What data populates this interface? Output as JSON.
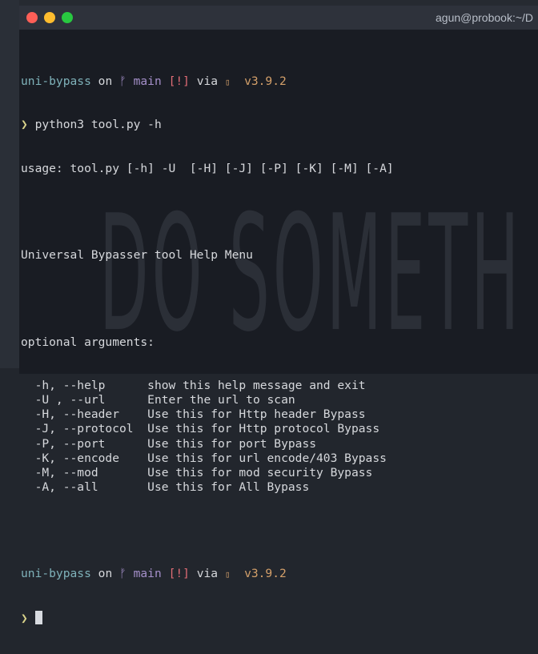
{
  "window": {
    "title": "agun@probook:~/D"
  },
  "prompt": {
    "dir": "uni-bypass",
    "on": "on",
    "branch_icon": "git-branch-icon",
    "branch_glyph": "ᚠ",
    "branch": "main",
    "status": "[!]",
    "via": "via",
    "python_icon": "python-icon",
    "python_glyph": "▯",
    "version": "v3.9.2",
    "arrow": "❯"
  },
  "command": "python3 tool.py -h",
  "usage": "usage: tool.py [-h] -U  [-H] [-J] [-P] [-K] [-M] [-A]",
  "heading": "Universal Bypasser tool Help Menu",
  "section": "optional arguments:",
  "arguments": [
    {
      "flag": "  -h, --help      ",
      "desc": "show this help message and exit"
    },
    {
      "flag": "  -U , --url      ",
      "desc": "Enter the url to scan"
    },
    {
      "flag": "  -H, --header    ",
      "desc": "Use this for Http header Bypass"
    },
    {
      "flag": "  -J, --protocol  ",
      "desc": "Use this for Http protocol Bypass"
    },
    {
      "flag": "  -P, --port      ",
      "desc": "Use this for port Bypass"
    },
    {
      "flag": "  -K, --encode    ",
      "desc": "Use this for url encode/403 Bypass"
    },
    {
      "flag": "  -M, --mod       ",
      "desc": "Use this for mod security Bypass"
    },
    {
      "flag": "  -A, --all       ",
      "desc": "Use this for All Bypass"
    }
  ],
  "wallpaper_text": "DO SOMETH",
  "colors": {
    "close": "#fe5f57",
    "minimize": "#febc2e",
    "maximize": "#28c840"
  }
}
